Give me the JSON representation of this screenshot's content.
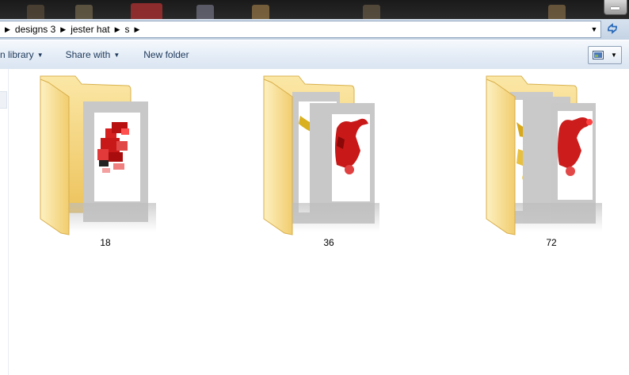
{
  "address": {
    "breadcrumbs": [
      "designs 3",
      "jester hat",
      "s"
    ]
  },
  "toolbar": {
    "library_label": "n library",
    "share_label": "Share with",
    "new_folder_label": "New folder"
  },
  "icons": {
    "breadcrumb_separator": "triangle-right-icon",
    "dropdown": "chevron-down-icon",
    "refresh": "refresh-icon",
    "view": "view-options-icon",
    "folder": "folder-icon"
  },
  "colors": {
    "toolbar_text": "#1e395b",
    "folder_yellow": "#f3d37a",
    "preview_red": "#c8101a"
  },
  "folders": [
    {
      "name": "18"
    },
    {
      "name": "36"
    },
    {
      "name": "72"
    }
  ]
}
